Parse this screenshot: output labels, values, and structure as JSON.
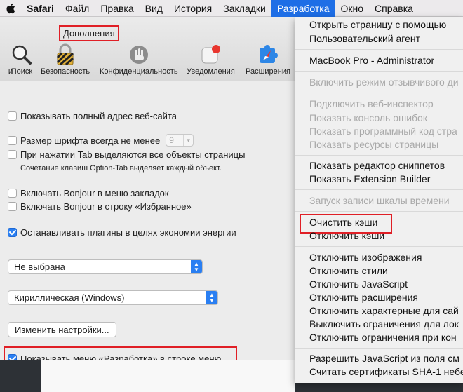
{
  "menubar": {
    "apple_icon": "apple-logo-icon",
    "items": [
      "Safari",
      "Файл",
      "Правка",
      "Вид",
      "История",
      "Закладки",
      "Разработка",
      "Окно",
      "Справка"
    ]
  },
  "prefs": {
    "title": "Дополнения",
    "toolbar": [
      "и",
      "Поиск",
      "Безопасность",
      "Конфиденциальность",
      "Уведомления",
      "Расширения"
    ],
    "show_full_address": "Показывать полный адрес веб-сайта",
    "font_size_label": "Размер шрифта всегда не менее",
    "font_size_value": "9",
    "tab_highlight": "При нажатии Tab выделяются все объекты страницы",
    "tab_note": "Сочетание клавиш Option-Tab выделяет каждый объект.",
    "bonjour_bookmarks": "Включать Bonjour в меню закладок",
    "bonjour_favorites": "Включать Bonjour в строку «Избранное»",
    "stop_plugins": "Останавливать плагины в целях экономии энергии",
    "select1": "Не выбрана",
    "select2": "Кириллическая (Windows)",
    "change_settings": "Изменить настройки...",
    "show_develop": "Показывать меню «Разработка» в строке меню"
  },
  "dropdown": {
    "open_page_with": "Открыть страницу с помощью",
    "user_agent": "Пользовательский агент",
    "macbook": "MacBook Pro - Administrator",
    "responsive": "Включить режим отзывчивого ди",
    "connect_inspector": "Подключить веб-инспектор",
    "show_console": "Показать консоль ошибок",
    "show_source": "Показать программный код стра",
    "show_resources": "Показать ресурсы страницы",
    "snippet_editor": "Показать редактор сниппетов",
    "extension_builder": "Показать Extension Builder",
    "timeline": "Запуск записи шкалы времени",
    "clear_cache": "Очистить кэши",
    "disable_cache": "Отключить кэши",
    "disable_images": "Отключить изображения",
    "disable_styles": "Отключить стили",
    "disable_js": "Отключить JavaScript",
    "disable_extensions": "Отключить расширения",
    "disable_site_hacks": "Отключить характерные для сай",
    "disable_local_restrictions": "Выключить ограничения для лок",
    "disable_cross_origin": "Отключить ограничения при кон",
    "allow_js_search": "Разрешить JavaScript из поля см",
    "sha1": "Считать сертификаты SHA-1 небе"
  },
  "colors": {
    "accent": "#1e6ee6",
    "highlight": "#e01f26"
  }
}
